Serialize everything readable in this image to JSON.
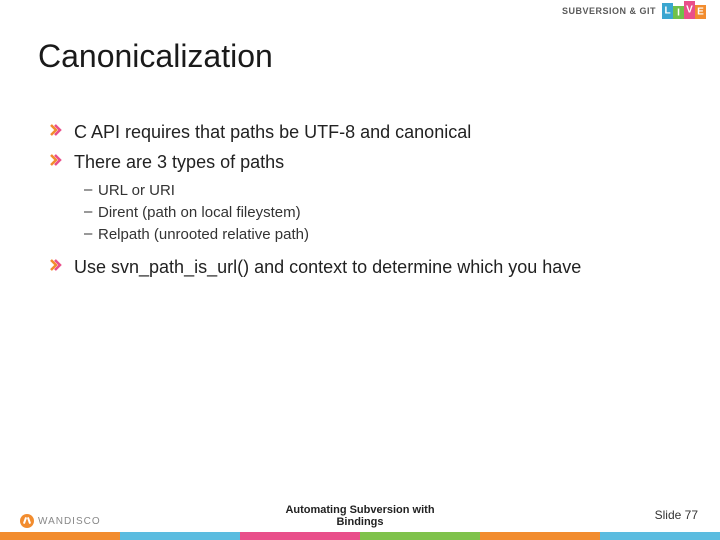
{
  "header": {
    "tagline": "SUBVERSION & GIT",
    "live": [
      "L",
      "I",
      "V",
      "E"
    ]
  },
  "title": "Canonicalization",
  "bullets": {
    "b1": "C API requires that paths be UTF-8 and canonical",
    "b2": "There are 3 types of paths",
    "sub": {
      "s1": "URL or URI",
      "s2": "Dirent (path on local fileystem)",
      "s3": "Relpath (unrooted relative path)"
    },
    "b3": "Use svn_path_is_url() and context to determine which you have"
  },
  "footer": {
    "title_line1": "Automating Subversion with",
    "title_line2": "Bindings",
    "slide_label": "Slide 77",
    "logo_text": "WANDISCO"
  }
}
